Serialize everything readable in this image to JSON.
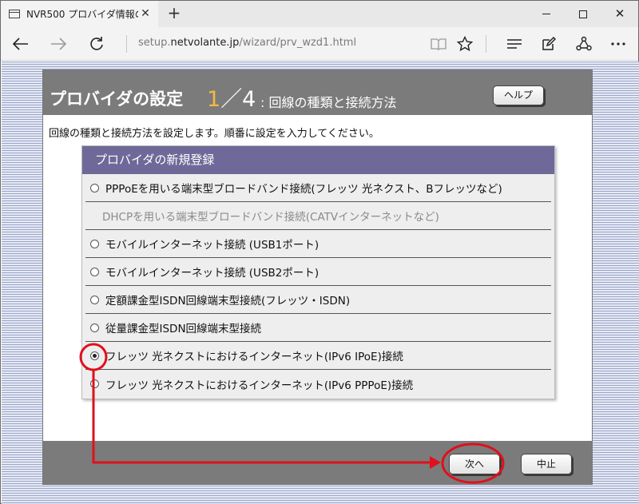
{
  "browser": {
    "tab_title": "NVR500 プロバイダ情報の",
    "url_prefix": "setup.",
    "url_host": "netvolante.jp",
    "url_path": "/wizard/prv_wzd1.html",
    "icons": [
      "back-icon",
      "forward-icon",
      "refresh-icon",
      "reading-view-icon",
      "favorite-star-icon",
      "hub-icon",
      "notes-icon",
      "share-icon",
      "more-icon"
    ]
  },
  "dialog": {
    "title": "プロバイダの設定",
    "step_current": "1",
    "step_sep_total": "／4",
    "subtitle": ": 回線の種類と接続方法",
    "help_label": "ヘルプ",
    "description": "回線の種類と接続方法を設定します。順番に設定を入力してください。",
    "panel_title": "プロバイダの新規登録",
    "options": [
      {
        "label": "PPPoEを用いる端末型ブロードバンド接続(フレッツ 光ネクスト、Bフレッツなど)",
        "enabled": true,
        "selected": false
      },
      {
        "label": "DHCPを用いる端末型ブロードバンド接続(CATVインターネットなど)",
        "enabled": false,
        "selected": false
      },
      {
        "label": "モバイルインターネット接続 (USB1ポート)",
        "enabled": true,
        "selected": false
      },
      {
        "label": "モバイルインターネット接続 (USB2ポート)",
        "enabled": true,
        "selected": false
      },
      {
        "label": "定額課金型ISDN回線端末型接続(フレッツ・ISDN)",
        "enabled": true,
        "selected": false
      },
      {
        "label": "従量課金型ISDN回線端末型接続",
        "enabled": true,
        "selected": false
      },
      {
        "label": "フレッツ 光ネクストにおけるインターネット(IPv6 IPoE)接続",
        "enabled": true,
        "selected": true
      },
      {
        "label": "フレッツ 光ネクストにおけるインターネット(IPv6 PPPoE)接続",
        "enabled": true,
        "selected": false
      }
    ],
    "next_label": "次へ",
    "cancel_label": "中止"
  },
  "colors": {
    "header_gray": "#7b7b7b",
    "step_accent": "#f5b942",
    "panel_purple": "#6f6999",
    "annotation_red": "#e0101c"
  }
}
